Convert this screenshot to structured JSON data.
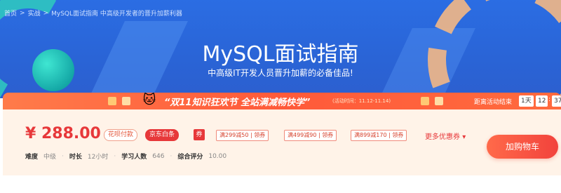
{
  "breadcrumb": {
    "items": [
      "首页",
      "实战",
      "MySQL面试指南 中高级开发者的晋升加薪利器"
    ],
    "separator": ">"
  },
  "hero": {
    "title": "MySQL面试指南",
    "subtitle": "中高级IT开发人员晋升加薪的必备佳品!"
  },
  "promo": {
    "headline": "“双11知识狂欢节 全站满减畅快学”",
    "period": "(活动时间：11.12-11.14)",
    "countdown_label": "距离活动结束",
    "countdown": {
      "days": "1天",
      "hours": "12",
      "minutes": "37"
    }
  },
  "pricing": {
    "price": "¥ 288.00",
    "tags": [
      "花呗付款",
      "京东白条"
    ],
    "coupon_icon": "券",
    "coupons": [
      "满299减50 | 领券",
      "满499减90 | 领券",
      "满899减170 | 领券"
    ],
    "more_coupons": "更多优惠券",
    "more_coupons_arrow": "▾"
  },
  "meta": {
    "difficulty_label": "难度",
    "difficulty": "中级",
    "duration_label": "时长",
    "duration": "12小时",
    "learners_label": "学习人数",
    "learners": "646",
    "rating_label": "综合评分",
    "rating": "10.00"
  },
  "actions": {
    "add_to_cart": "加购物车"
  },
  "colors": {
    "hero_blue": "#2b6de3",
    "promo_orange": "#ff5a3a",
    "price_red": "#e7383a"
  }
}
